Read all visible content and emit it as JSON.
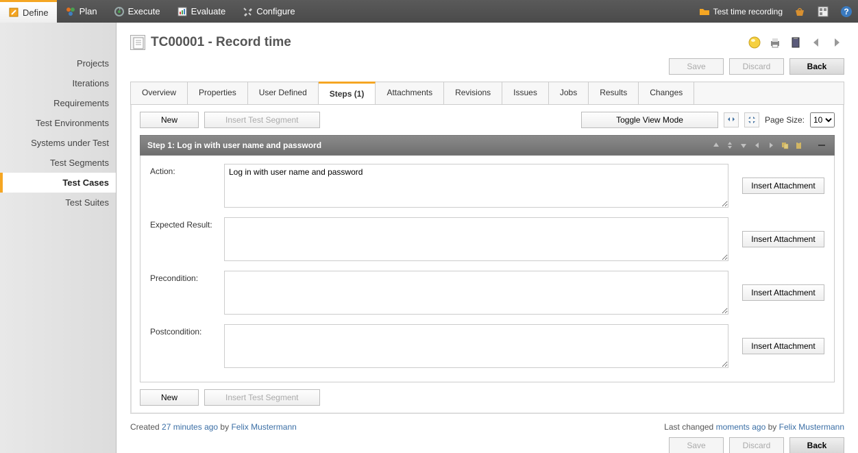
{
  "toolbar": {
    "define": "Define",
    "plan": "Plan",
    "execute": "Execute",
    "evaluate": "Evaluate",
    "configure": "Configure",
    "test_time_recording": "Test time recording"
  },
  "sidebar": {
    "items": [
      {
        "label": "Projects"
      },
      {
        "label": "Iterations"
      },
      {
        "label": "Requirements"
      },
      {
        "label": "Test Environments"
      },
      {
        "label": "Systems under Test"
      },
      {
        "label": "Test Segments"
      },
      {
        "label": "Test Cases"
      },
      {
        "label": "Test Suites"
      }
    ]
  },
  "page": {
    "title": "TC00001 - Record time",
    "save": "Save",
    "discard": "Discard",
    "back": "Back"
  },
  "tabs": {
    "overview": "Overview",
    "properties": "Properties",
    "user_defined": "User Defined",
    "steps": "Steps (1)",
    "attachments": "Attachments",
    "revisions": "Revisions",
    "issues": "Issues",
    "jobs": "Jobs",
    "results": "Results",
    "changes": "Changes"
  },
  "steps": {
    "new": "New",
    "insert_test_segment": "Insert Test Segment",
    "toggle_view_mode": "Toggle View Mode",
    "page_size_label": "Page Size:",
    "page_size_value": "10",
    "step_title": "Step 1: Log in with user name and password",
    "action_label": "Action:",
    "action_value": "Log in with user name and password",
    "expected_label": "Expected Result:",
    "expected_value": "",
    "precondition_label": "Precondition:",
    "precondition_value": "",
    "postcondition_label": "Postcondition:",
    "postcondition_value": "",
    "insert_attachment": "Insert Attachment"
  },
  "meta": {
    "created_prefix": "Created ",
    "created_time": "27 minutes ago",
    "created_by": " by ",
    "created_user": "Felix Mustermann",
    "changed_prefix": "Last changed ",
    "changed_time": "moments ago",
    "changed_by": " by ",
    "changed_user": "Felix Mustermann"
  }
}
